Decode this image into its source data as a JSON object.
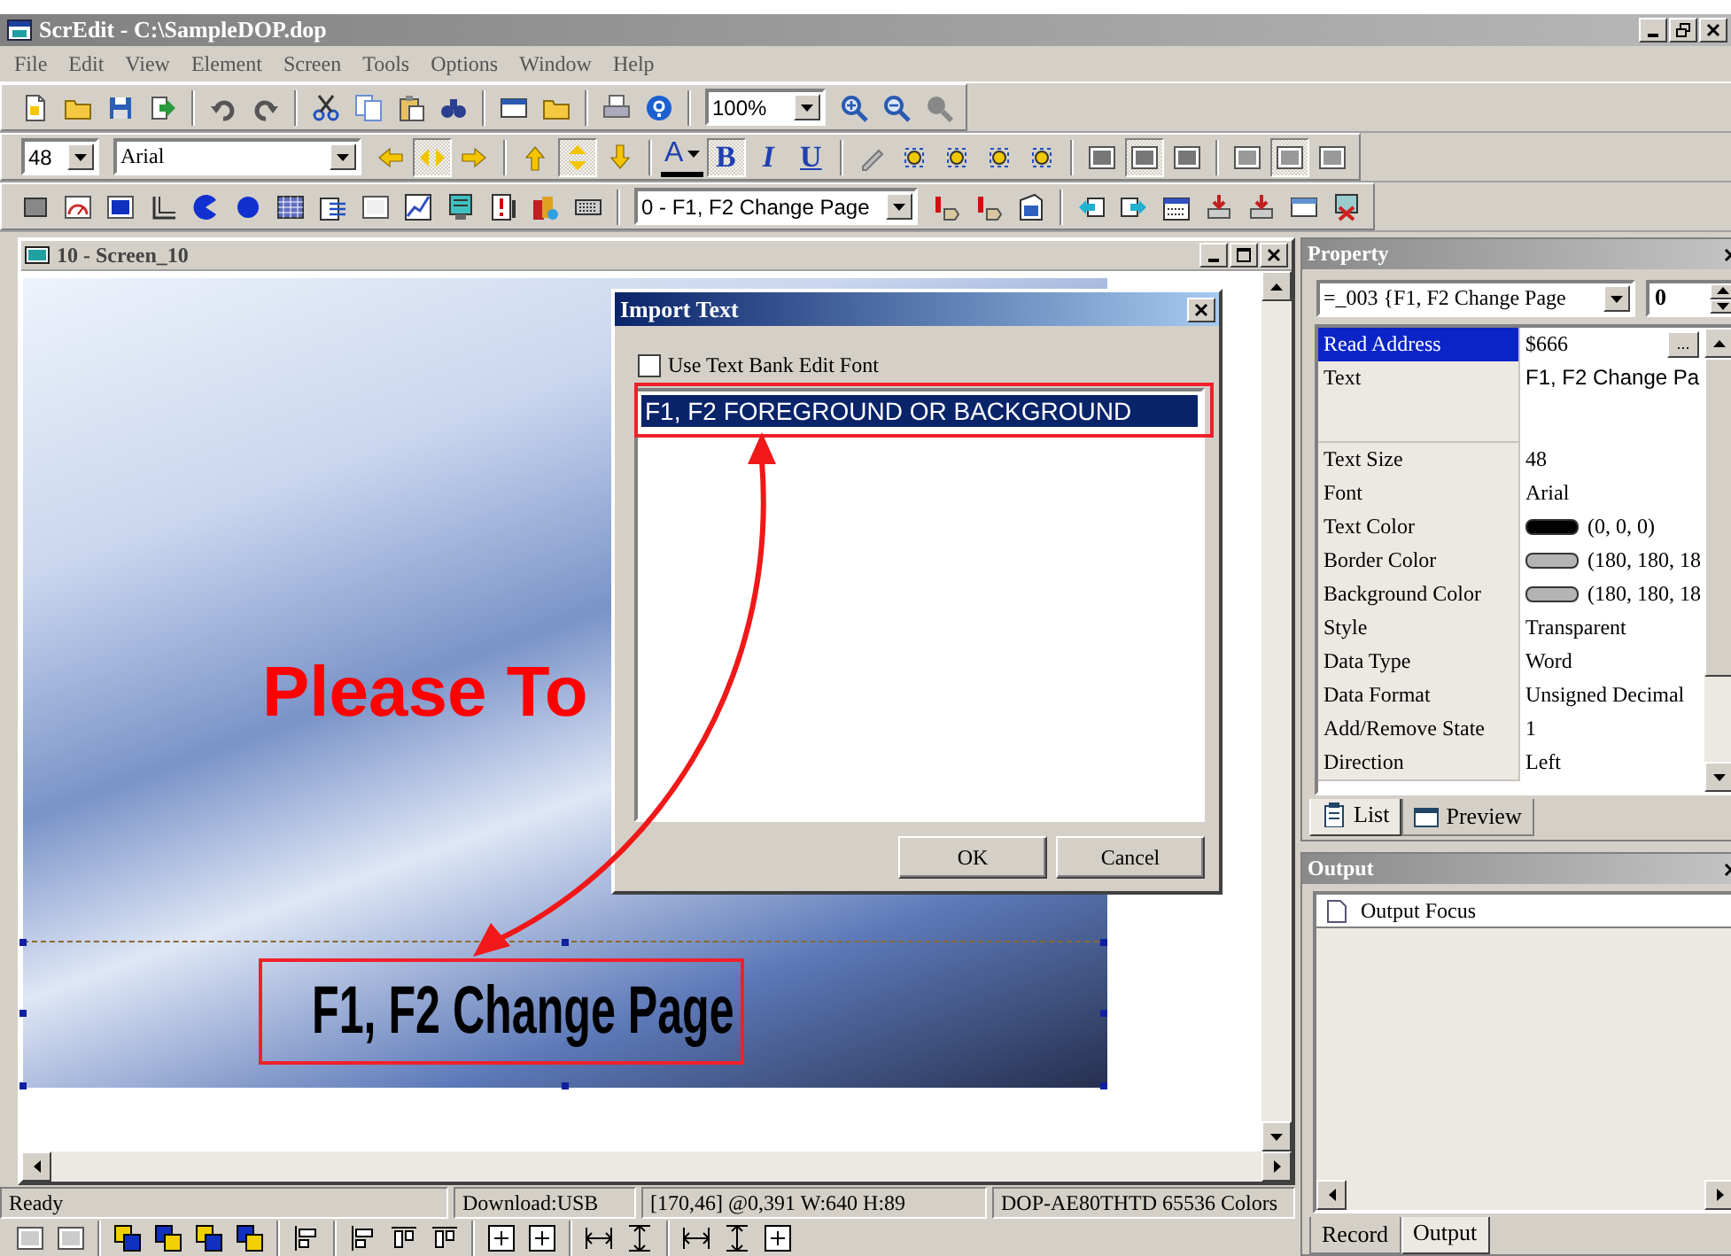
{
  "window": {
    "title": "ScrEdit - C:\\SampleDOP.dop"
  },
  "menu": [
    "File",
    "Edit",
    "View",
    "Element",
    "Screen",
    "Tools",
    "Options",
    "Window",
    "Help"
  ],
  "toolbar": {
    "zoom": "100%"
  },
  "format_bar": {
    "font_size": "48",
    "font": "Arial",
    "h_align": [
      {
        "pressed": false
      },
      {
        "pressed": true
      },
      {
        "pressed": false
      }
    ],
    "v_align": [
      {
        "pressed": false
      },
      {
        "pressed": true
      },
      {
        "pressed": false
      }
    ],
    "text_color": "A",
    "styles": [
      {
        "label": "B",
        "pressed": true
      },
      {
        "label": "I",
        "pressed": false
      },
      {
        "label": "U",
        "pressed": false
      }
    ],
    "layout": [
      {
        "pressed": false
      },
      {
        "pressed": true
      },
      {
        "pressed": false
      },
      {
        "pressed": false
      },
      {
        "pressed": true
      },
      {
        "pressed": false
      }
    ]
  },
  "element_bar": {
    "screen": "0 - F1, F2  Change Page"
  },
  "screen_window": {
    "title": "10 - Screen_10",
    "texts": [
      {
        "text": "Please To",
        "color": "#ff0000"
      },
      {
        "text": "F1, F2  Change Page",
        "color": "#000000"
      }
    ]
  },
  "dialog": {
    "title": "Import Text",
    "checkbox": {
      "label": "Use Text Bank Edit Font",
      "checked": false
    },
    "items": [
      {
        "text": "F1, F2 FOREGROUND OR BACKGROUND",
        "selected": true
      }
    ],
    "buttons": [
      "OK",
      "Cancel"
    ]
  },
  "property": {
    "title": "Property",
    "object": "=_003 {F1, F2  Change Page",
    "state": "0",
    "browse": "...",
    "rows": [
      {
        "name": "Read Address",
        "value": "$666",
        "kind": "address",
        "selected": true
      },
      {
        "name": "Text",
        "value": "F1, F2  Change Pa",
        "kind": "multiline",
        "selected": false
      },
      {
        "name": "Text Size",
        "value": "48",
        "kind": "text",
        "selected": false
      },
      {
        "name": "Font",
        "value": "Arial",
        "kind": "text",
        "selected": false
      },
      {
        "name": "Text Color",
        "value": "(0, 0, 0)",
        "kind": "color",
        "color": "#000000",
        "selected": false
      },
      {
        "name": "Border Color",
        "value": "(180, 180, 18",
        "kind": "color",
        "color": "#b4b4b4",
        "selected": false
      },
      {
        "name": "Background Color",
        "value": "(180, 180, 18",
        "kind": "color",
        "color": "#b4b4b4",
        "selected": false
      },
      {
        "name": "Style",
        "value": "Transparent",
        "kind": "text",
        "selected": false
      },
      {
        "name": "Data Type",
        "value": "Word",
        "kind": "text",
        "selected": false
      },
      {
        "name": "Data Format",
        "value": "Unsigned Decimal",
        "kind": "text",
        "selected": false
      },
      {
        "name": "Add/Remove State",
        "value": "1",
        "kind": "text",
        "selected": false
      },
      {
        "name": "Direction",
        "value": "Left",
        "kind": "text",
        "selected": false
      }
    ],
    "tabs": [
      {
        "label": "List",
        "selected": true
      },
      {
        "label": "Preview",
        "selected": false
      }
    ]
  },
  "output": {
    "title": "Output",
    "header": "Output Focus",
    "tabs": [
      {
        "label": "Record",
        "selected": false
      },
      {
        "label": "Output",
        "selected": true
      }
    ]
  },
  "status_bar": [
    "Ready",
    "Download:USB",
    "[170,46] @0,391 W:640 H:89",
    "DOP-AE80THTD 65536 Colors"
  ]
}
